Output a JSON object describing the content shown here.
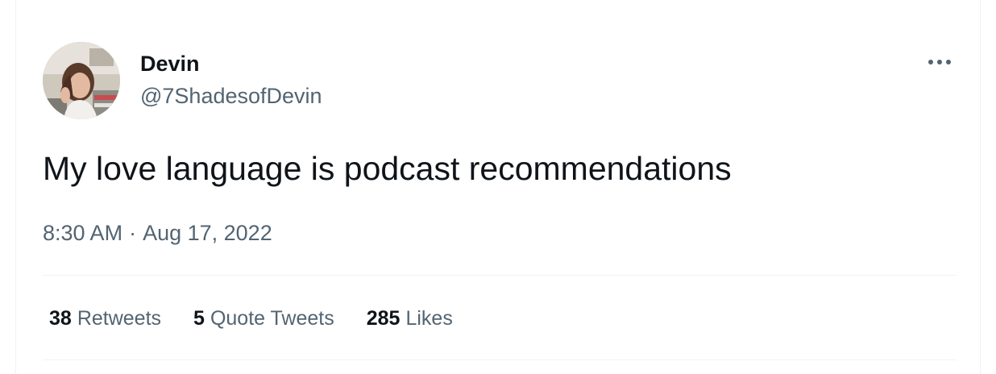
{
  "author": {
    "name": "Devin",
    "handle": "@7ShadesofDevin",
    "avatar_icon": "profile-photo"
  },
  "tweet": {
    "text": "My love language is podcast recommendations",
    "time": "8:30 AM",
    "separator": "·",
    "date": "Aug 17, 2022"
  },
  "stats": {
    "retweets": {
      "count": "38",
      "label": "Retweets"
    },
    "quotes": {
      "count": "5",
      "label": "Quote Tweets"
    },
    "likes": {
      "count": "285",
      "label": "Likes"
    }
  },
  "icons": {
    "more": "more-horizontal-icon"
  },
  "colors": {
    "primary_text": "#0f1419",
    "secondary_text": "#536471",
    "divider": "#eff3f4"
  }
}
